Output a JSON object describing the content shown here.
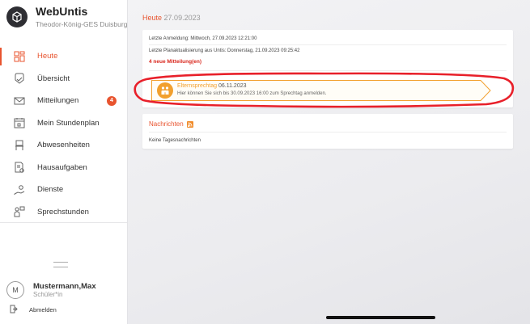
{
  "brand": {
    "title": "WebUntis",
    "school": "Theodor-König-GES Duisburg"
  },
  "nav": [
    {
      "label": "Heute",
      "icon": "dashboard-icon",
      "active": true
    },
    {
      "label": "Übersicht",
      "icon": "overview-icon"
    },
    {
      "label": "Mitteilungen",
      "icon": "mail-icon",
      "badge": "4"
    },
    {
      "label": "Mein Stundenplan",
      "icon": "calendar-icon"
    },
    {
      "label": "Abwesenheiten",
      "icon": "chair-icon"
    },
    {
      "label": "Hausaufgaben",
      "icon": "homework-icon"
    },
    {
      "label": "Dienste",
      "icon": "duty-icon"
    },
    {
      "label": "Sprechstunden",
      "icon": "consultation-icon"
    }
  ],
  "user": {
    "initial": "M",
    "name": "Mustermann,Max",
    "role": "Schüler*in",
    "logout": "Abmelden"
  },
  "today": {
    "label": "Heute",
    "date": "27.09.2023"
  },
  "info": {
    "last_login": "Letzte Anmeldung: Mittwoch, 27.09.2023 12:21:00",
    "last_update": "Letzte Planaktualisierung aus Untis: Donnerstag, 21.09.2023 09:25:42",
    "new_messages": "4 neue Mitteilung(en)"
  },
  "event": {
    "title": "Elternsprechtag",
    "date": "06.11.2023",
    "description": "Hier können Sie sich bis 30.09.2023 16:00 zum Sprechtag anmelden."
  },
  "news": {
    "title": "Nachrichten",
    "empty": "Keine Tagesnachrichten"
  },
  "colors": {
    "accent": "#e8542f",
    "event": "#f2a02e",
    "highlight_ring": "#e8202a"
  }
}
